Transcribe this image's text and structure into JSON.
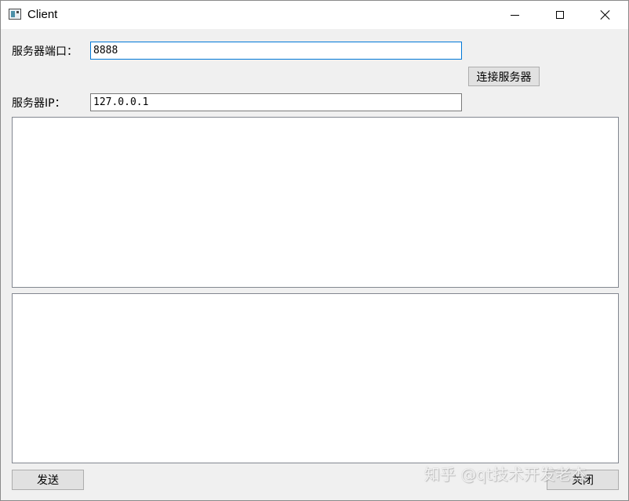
{
  "window": {
    "title": "Client",
    "icon": "app-window-icon",
    "controls": {
      "minimize_icon": "minimize-icon",
      "maximize_icon": "maximize-icon",
      "close_icon": "close-icon"
    }
  },
  "form": {
    "port_label": "服务器端口：",
    "port_value": "8888",
    "ip_label": "服务器IP：",
    "ip_value": "127.0.0.1",
    "connect_label": "连接服务器"
  },
  "footer": {
    "send_label": "发送",
    "close_label": "关闭"
  },
  "watermark": "知乎 @qt技术开发老杰",
  "colors": {
    "focus_border": "#0078d7",
    "window_bg": "#f0f0f0",
    "button_bg": "#e1e1e1"
  }
}
